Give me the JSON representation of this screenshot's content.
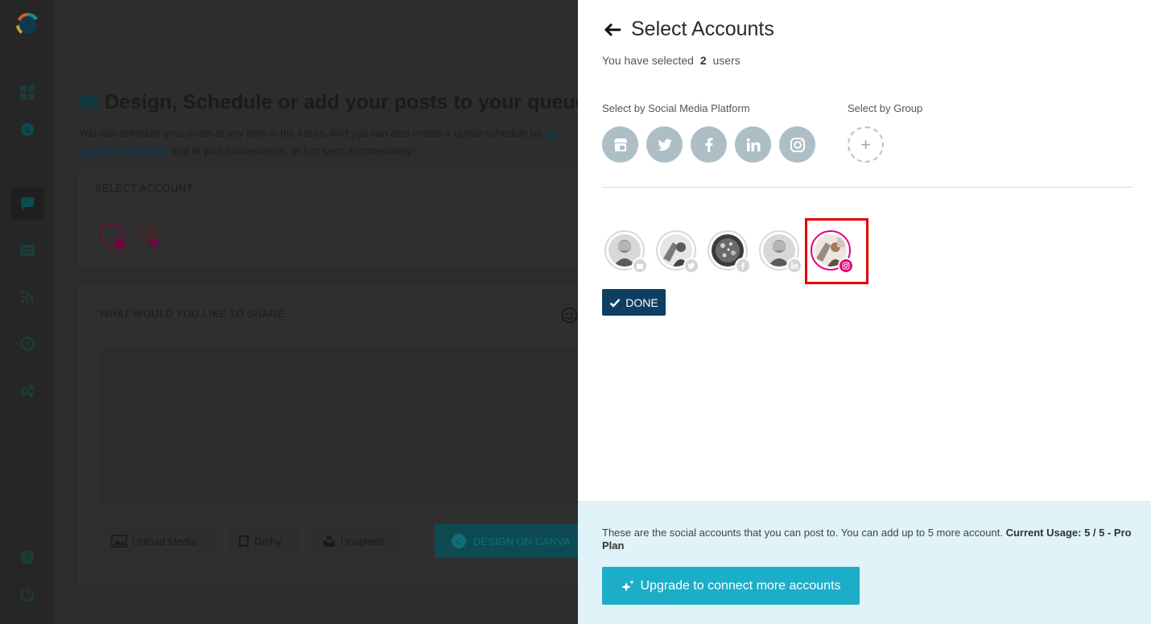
{
  "background": {
    "title": "Design, Schedule or add your posts to your queue",
    "desc_line1_text": "You can schedule your posts at any time in the future. And you can also create a queue schedule by ",
    "desc_line1_link": "se",
    "desc_line2_link": "posting-time slots",
    "desc_line2_text": " that fit your convenience, or just send it immediately!",
    "select_account_label": "SELECT ACCOUNT",
    "share_label": "WHAT WOULD YOU LIKE TO SHARE",
    "upload_media": "Upload Media",
    "giphy": "Giphy",
    "unsplash": "Unsplash",
    "design_canva": "DESIGN ON CANVA"
  },
  "panel": {
    "title": "Select Accounts",
    "selected_prefix": "You have selected",
    "selected_count": "2",
    "selected_suffix": "users",
    "platform_label": "Select by Social Media Platform",
    "group_label": "Select by Group",
    "platforms": [
      "google-my-business-icon",
      "twitter-icon",
      "facebook-icon",
      "linkedin-icon",
      "instagram-icon"
    ],
    "done_label": "DONE",
    "footer_text": "These are the social accounts that you can post to. You can add up to 5 more account.",
    "footer_usage": "Current Usage: 5 / 5 - Pro Plan",
    "upgrade_label": "Upgrade to connect more accounts"
  },
  "colors": {
    "accent": "#0e3f63",
    "instagram": "#e4007c",
    "upgrade": "#1cadc8",
    "highlight": "#e00000"
  }
}
